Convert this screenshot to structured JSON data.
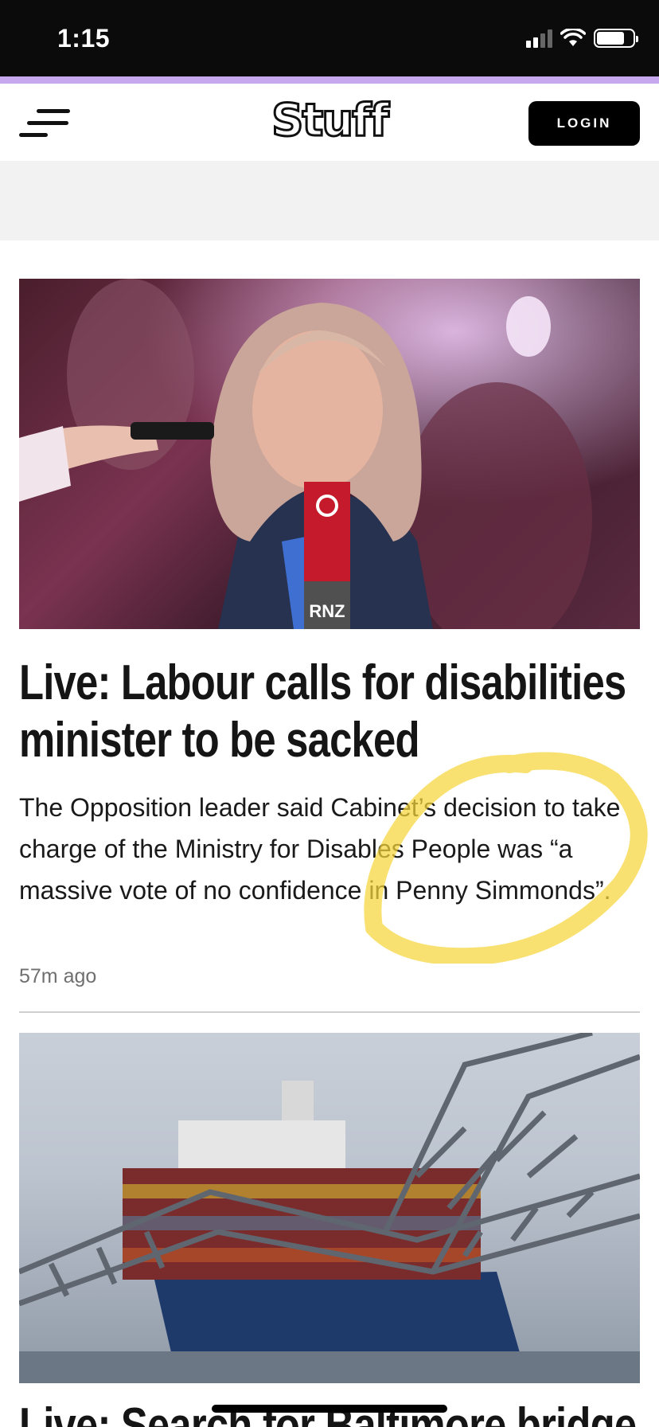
{
  "status_bar": {
    "time": "1:15"
  },
  "header": {
    "logo_text": "Stuff",
    "login_label": "LOGIN",
    "accent_color": "#c7a8ef"
  },
  "articles": [
    {
      "image_badge": "RNZ",
      "headline": "Live: Labour calls for disabilities minister to be sacked",
      "summary": "The Opposition leader said Cabinet’s decision to take charge of the Ministry for Disables People was “a massive vote of no confidence in Penny Simmonds”.",
      "timestamp": "57m ago"
    },
    {
      "headline": "Live: Search for Baltimore bridge"
    }
  ],
  "annotation": {
    "color": "#f7d53a",
    "icon": "yellow-circle-annotation"
  }
}
